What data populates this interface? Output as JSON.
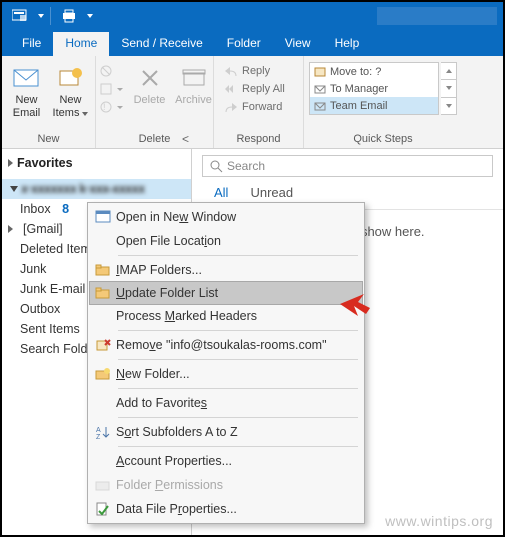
{
  "tabs": {
    "file": "File",
    "home": "Home",
    "send_receive": "Send / Receive",
    "folder": "Folder",
    "view": "View",
    "help": "Help"
  },
  "ribbon": {
    "new_email": "New\nEmail",
    "new_items": "New\nItems",
    "delete": "Delete",
    "archive": "Archive",
    "reply": "Reply",
    "reply_all": "Reply All",
    "forward": "Forward",
    "move_to": "Move to: ?",
    "to_manager": "To Manager",
    "team_email": "Team Email",
    "group_new": "New",
    "group_delete": "Delete",
    "group_respond": "Respond",
    "group_quicksteps": "Quick Steps"
  },
  "nav": {
    "favorites": "Favorites",
    "account_masked": "x·xxxxxxx k·xxx-xxxxx",
    "inbox": "Inbox",
    "inbox_count": "8",
    "gmail": "[Gmail]",
    "deleted": "Deleted Items",
    "junk": "Junk",
    "junk_email": "Junk E-mail",
    "outbox": "Outbox",
    "sent": "Sent Items",
    "search_folders": "Search Folders"
  },
  "search": {
    "placeholder": "Search"
  },
  "filters": {
    "all": "All",
    "unread": "Unread"
  },
  "empty_msg": "We didn't find anything to show here.",
  "ctx": {
    "open_new_window": "Open in New Window",
    "open_file_location": "Open File Location",
    "imap_folders": "IMAP Folders...",
    "update_folder_list": "Update Folder List",
    "process_marked": "Process Marked Headers",
    "remove": "Remove \"info@tsoukalas-rooms.com\"",
    "new_folder": "New Folder...",
    "add_favorites": "Add to Favorites",
    "sort_az": "Sort Subfolders A to Z",
    "account_props": "Account Properties...",
    "folder_permissions": "Folder Permissions",
    "data_file_props": "Data File Properties..."
  },
  "watermark": "www.wintips.org"
}
